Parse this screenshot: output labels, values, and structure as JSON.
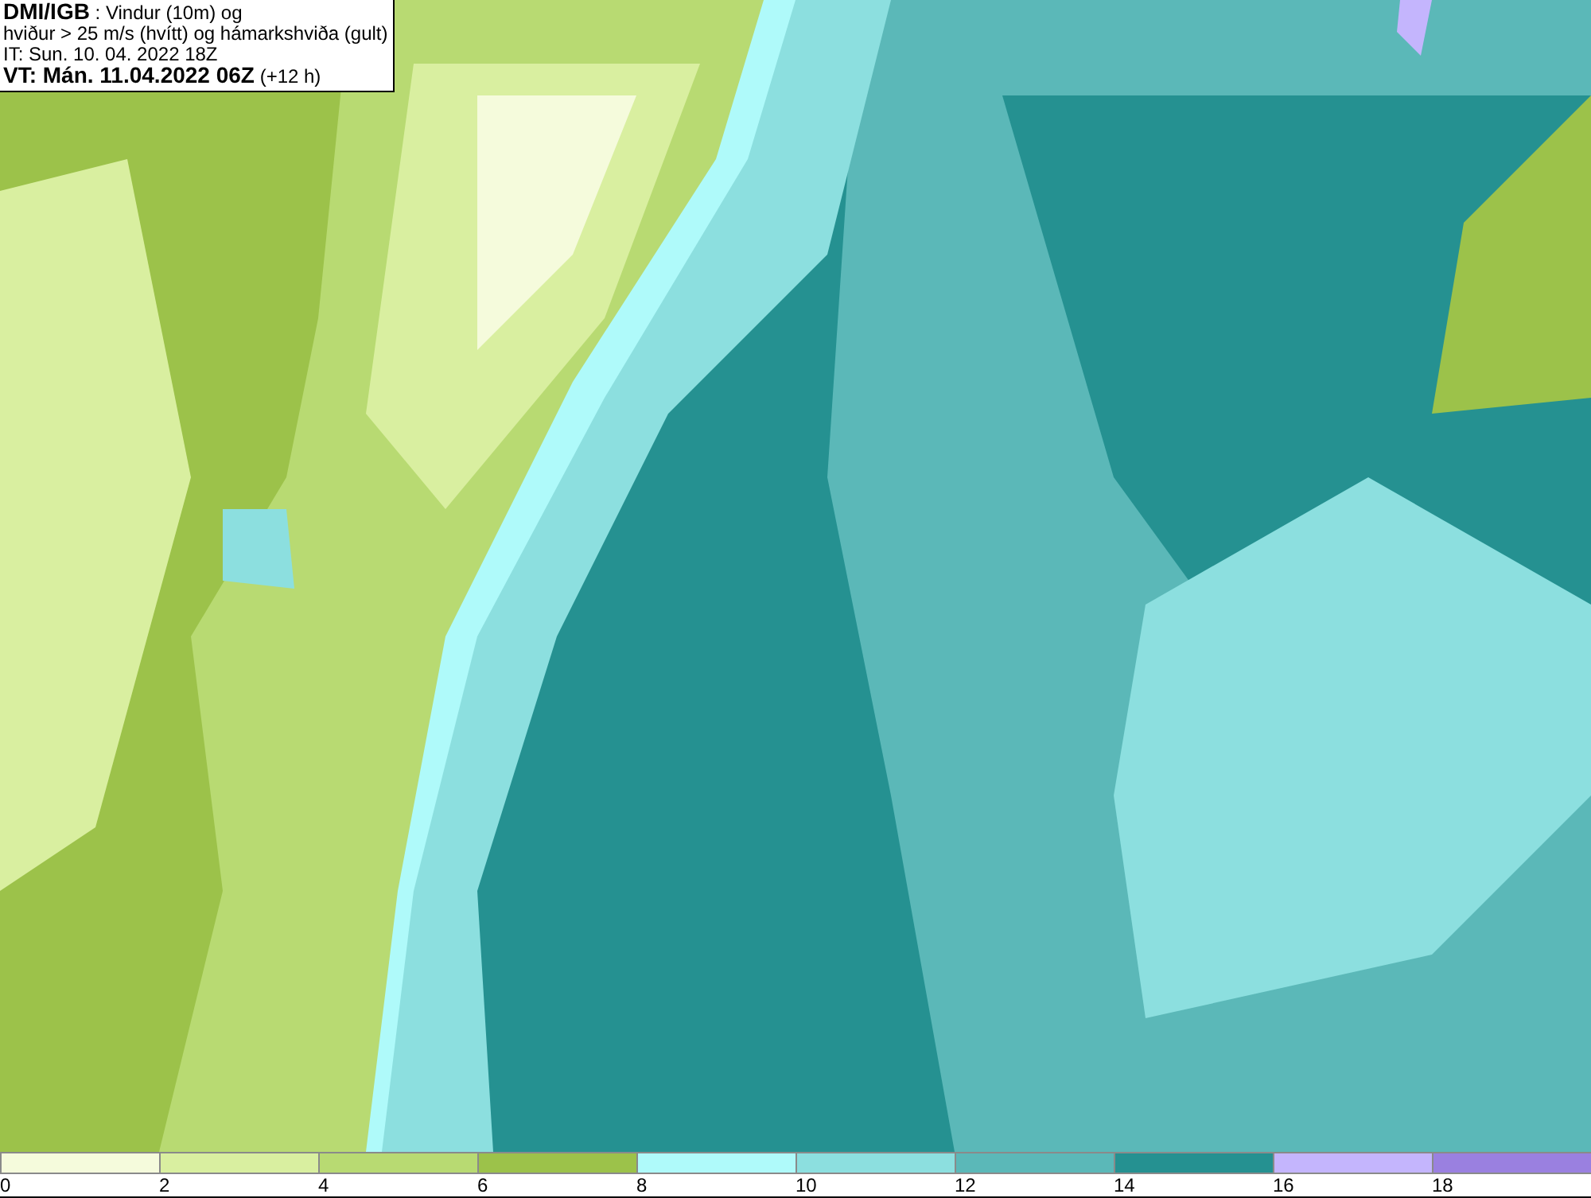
{
  "header": {
    "lines": [
      "**DMI/IGB** : Vindur (10m) og",
      "hviður > 25 m/s (hvítt) og hámarkshviða (gult)",
      "IT: Sun. 10. 04. 2022 18Z",
      "**VT: Mán. 11.04.2022 06Z** (+12 h)"
    ]
  },
  "legend": [
    {
      "label": "0",
      "color": "#f5fbdc"
    },
    {
      "label": "2",
      "color": "#d9efa0"
    },
    {
      "label": "4",
      "color": "#b8da72"
    },
    {
      "label": "6",
      "color": "#9cc24a"
    },
    {
      "label": "8",
      "color": "#affafa"
    },
    {
      "label": "10",
      "color": "#8cdfdf"
    },
    {
      "label": "12",
      "color": "#5bb8b8"
    },
    {
      "label": "14",
      "color": "#259191"
    },
    {
      "label": "16",
      "color": "#c4b5fd"
    },
    {
      "label": "18",
      "color": "#9a80e0"
    }
  ]
}
